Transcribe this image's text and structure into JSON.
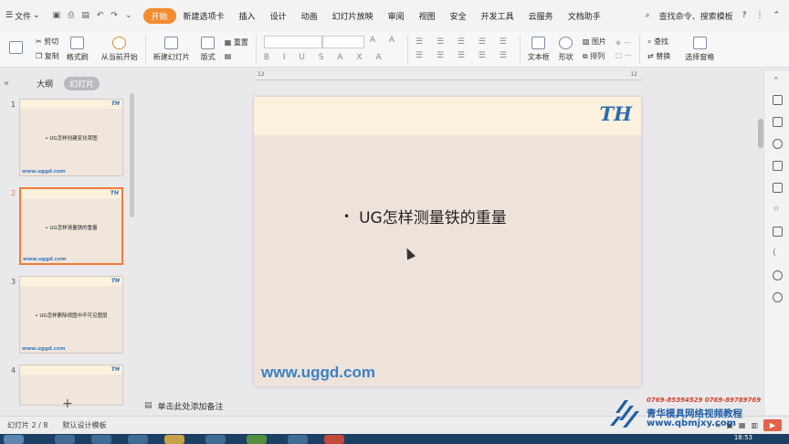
{
  "menubar": {
    "file_label": "文件",
    "tabs": [
      "开始",
      "新建选项卡",
      "插入",
      "设计",
      "动画",
      "幻灯片放映",
      "审阅",
      "视图",
      "安全",
      "开发工具",
      "云服务",
      "文档助手"
    ],
    "active_tab_index": 0,
    "search_label": "查找命令、搜索模板",
    "help_label": "?"
  },
  "ribbon": {
    "cut": "剪切",
    "copy": "复制",
    "format_painter": "格式刷",
    "from_current": "从当前开始",
    "new_slide": "新建幻灯片",
    "layout": "版式",
    "reset": "重置",
    "textbox": "文本框",
    "shape": "形状",
    "picture": "图片",
    "arrange": "排列",
    "find": "查找",
    "replace": "替换",
    "select_pane": "选择窗格"
  },
  "leftpane": {
    "tab_outline": "大纲",
    "tab_slides": "幻灯片",
    "thumbnails": [
      {
        "num": "1",
        "text": "• UG怎样创建变化草图",
        "url": "www.uggd.com",
        "logo": "TH"
      },
      {
        "num": "2",
        "text": "• UG怎样测量铁的重量",
        "url": "www.uggd.com",
        "logo": "TH"
      },
      {
        "num": "3",
        "text": "• UG怎样删除视图中不可见图层",
        "url": "www.uggd.com",
        "logo": "TH"
      },
      {
        "num": "4",
        "text": "",
        "url": "",
        "logo": "TH"
      }
    ],
    "selected_index": 1,
    "add_label": "+"
  },
  "ruler": {
    "left_mark": "12",
    "right_mark": "12"
  },
  "slide": {
    "logo": "TH",
    "title_bullet": "•",
    "title": "UG怎样测量铁的重量",
    "url": "www.uggd.com"
  },
  "notes": {
    "placeholder": "单击此处添加备注"
  },
  "status": {
    "slide_count": "幻灯片 2 / 8",
    "template": "默认设计模板"
  },
  "watermark": {
    "phone": "0769-85394529  0769-89789769",
    "org": "青华模具网络视频教程",
    "site": "www.qbmjxy.com"
  },
  "taskbar": {
    "clock": "18:53"
  }
}
